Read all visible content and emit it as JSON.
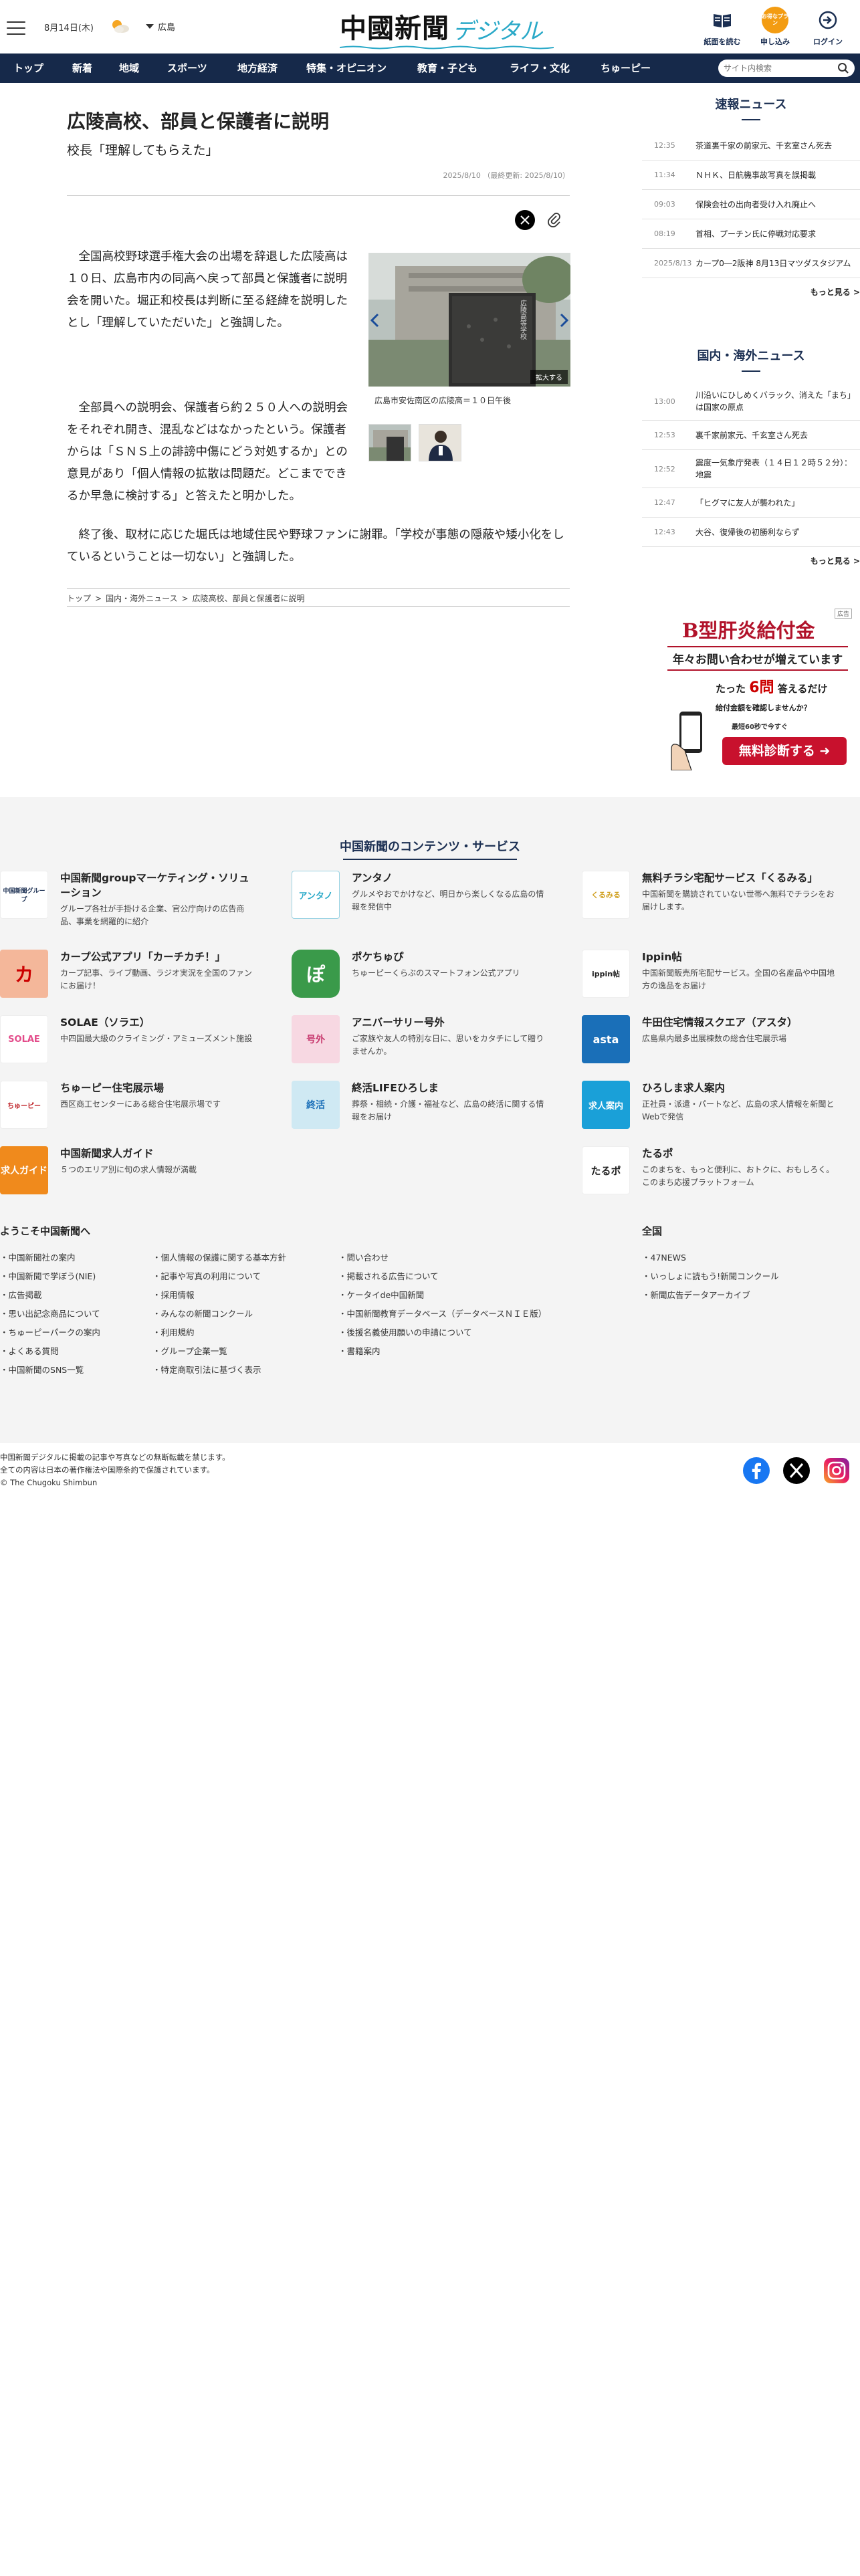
{
  "header": {
    "date": "8月14日(木)",
    "prefecture": "広島",
    "logo_main": "中國新聞",
    "logo_sub": "デジタル",
    "buttons": {
      "paper": "紙面を読む",
      "apply": "申し込み",
      "apply_badge": "お得なプラン",
      "login": "ログイン"
    }
  },
  "nav": {
    "items": [
      "トップ",
      "新着",
      "地域",
      "スポーツ",
      "地方経済",
      "特集・オピニオン",
      "教育・子ども",
      "ライフ・文化",
      "ちゅーピー"
    ],
    "search_placeholder": "サイト内検索"
  },
  "article": {
    "title": "広陵高校、部員と保護者に説明",
    "subtitle": "校長「理解してもらえた」",
    "date": "2025/8/10 （最終更新: 2025/8/10）",
    "paragraphs": [
      "全国高校野球選手権大会の出場を辞退した広陵高は１０日、広島市内の同高へ戻って部員と保護者に説明会を開いた。堀正和校長は判断に至る経緯を説明したとし「理解していただいた」と強調した。",
      "全部員への説明会、保護者ら約２５０人への説明会をそれぞれ開き、混乱などはなかったという。保護者からは「ＳＮＳ上の誹謗中傷にどう対処するか」との意見があり「個人情報の拡散は問題だ。どこまでできるか早急に検討する」と答えたと明かした。",
      "終了後、取材に応じた堀氏は地域住民や野球ファンに謝罪。「学校が事態の隠蔽や矮小化をしているということは一切ない」と強調した。"
    ],
    "photo_sign": "広陵高等学校",
    "enlarge": "拡大する",
    "caption": "広島市安佐南区の広陵高＝１０日午後",
    "breadcrumb": [
      "トップ",
      "国内・海外ニュース",
      "広陵高校、部員と保護者に説明"
    ]
  },
  "sidebar": {
    "breaking": {
      "title": "速報ニュース",
      "items": [
        {
          "time": "12:35",
          "text": "茶道裏千家の前家元、千玄室さん死去"
        },
        {
          "time": "11:34",
          "text": "ＮＨＫ、日航機事故写真を誤掲載"
        },
        {
          "time": "09:03",
          "text": "保険会社の出向者受け入れ廃止へ"
        },
        {
          "time": "08:19",
          "text": "首相、プーチン氏に停戦対応要求"
        },
        {
          "time": "2025/8/13",
          "text": "カープ0―2阪神 8月13日マツダスタジアム"
        }
      ],
      "more": "もっと見る"
    },
    "domestic": {
      "title": "国内・海外ニュース",
      "items": [
        {
          "time": "13:00",
          "text": "川沿いにひしめくバラック、消えた「まち」は国家の原点"
        },
        {
          "time": "12:53",
          "text": "裏千家前家元、千玄室さん死去"
        },
        {
          "time": "12:52",
          "text": "震度一気象庁発表（１４日１２時５２分）：地震"
        },
        {
          "time": "12:47",
          "text": "「ヒグマに友人が襲われた」"
        },
        {
          "time": "12:43",
          "text": "大谷、復帰後の初勝利ならず"
        }
      ],
      "more": "もっと見る"
    }
  },
  "ad": {
    "label": "広告",
    "headline": "B型肝炎給付金",
    "sub": "年々お問い合わせが増えています",
    "line1_pre": "たった",
    "line1_num": "6問",
    "line1_post": "答えるだけ",
    "line2": "給付金額を確認しませんか？",
    "line3": "最短60秒で今すぐ",
    "cta": "無料診断する"
  },
  "services": {
    "title": "中国新聞のコンテンツ・サービス",
    "items": [
      {
        "name": "中国新聞groupマーケティング・ソリューション",
        "desc": "グループ各社が手掛ける企業、官公庁向けの広告商品、事業を網羅的に紹介",
        "logo": "中国新聞グループ"
      },
      {
        "name": "アンタノ",
        "desc": "グルメやおでかけなど、明日から楽しくなる広島の情報を発信中",
        "logo": "アンタノ"
      },
      {
        "name": "無料チラシ宅配サービス「くるみる」",
        "desc": "中国新聞を購読されていない世帯へ無料でチラシをお届けします。",
        "logo": "くるみる"
      },
      {
        "name": "カープ公式アプリ「カーチカチ！」",
        "desc": "カープ記事、ライブ動画、ラジオ実況を全国のファンにお届け！",
        "logo": "カ"
      },
      {
        "name": "ポケちゅぴ",
        "desc": "ちゅーピーくらぶのスマートフォン公式アプリ",
        "logo": "ぽ"
      },
      {
        "name": "Ippin帖",
        "desc": "中国新聞販売所宅配サービス。全国の名産品や中国地方の逸品をお届け",
        "logo": "ippin帖"
      },
      {
        "name": "SOLAE（ソラエ）",
        "desc": "中四国最大級のクライミング・アミューズメント施設",
        "logo": "SOLAE"
      },
      {
        "name": "アニバーサリー号外",
        "desc": "ご家族や友人の特別な日に、思いをカタチにして贈りませんか。",
        "logo": "号外"
      },
      {
        "name": "牛田住宅情報スクエア（アスタ）",
        "desc": "広島県内最多出展棟数の総合住宅展示場",
        "logo": "asta"
      },
      {
        "name": "ちゅーピー住宅展示場",
        "desc": "西区商工センターにある総合住宅展示場です",
        "logo": "ちゅーピー"
      },
      {
        "name": "終活LIFEひろしま",
        "desc": "葬祭・相続・介護・福祉など、広島の終活に関する情報をお届け",
        "logo": "終活"
      },
      {
        "name": "ひろしま求人案内",
        "desc": "正社員・派遣・パートなど、広島の求人情報を新聞とWebで発信",
        "logo": "求人案内"
      },
      {
        "name": "中国新聞求人ガイド",
        "desc": "５つのエリア別に旬の求人情報が満載",
        "logo": "求人ガイド"
      },
      {
        "name": "たるポ",
        "desc": "このまちを、もっと便利に、おトクに、おもしろく。このまち応援プラットフォーム",
        "logo": "たるポ"
      }
    ]
  },
  "footer": {
    "welcome": "ようこそ中国新聞へ",
    "col1": [
      "中国新聞社の案内",
      "中国新聞で学ぼう(NIE)",
      "広告掲載",
      "思い出記念商品について",
      "ちゅーピーパークの案内",
      "よくある質問",
      "中国新聞のSNS一覧"
    ],
    "col2": [
      "個人情報の保護に関する基本方針",
      "記事や写真の利用について",
      "採用情報",
      "みんなの新聞コンクール",
      "利用規約",
      "グループ企業一覧",
      "特定商取引法に基づく表示"
    ],
    "col3": [
      "問い合わせ",
      "掲載される広告について",
      "ケータイde中国新聞",
      "中国新聞教育データベース（データベースＮＩＥ版）",
      "後援名義使用願いの申請について",
      "書籍案内"
    ],
    "national": "全国",
    "col4": [
      "47NEWS",
      "いっしょに読もう!新聞コンクール",
      "新聞広告データアーカイブ"
    ],
    "copyright": [
      "中国新聞デジタルに掲載の記事や写真などの無断転載を禁じます。",
      "全ての内容は日本の著作権法や国際条約で保護されています。",
      "© The Chugoku Shimbun"
    ]
  },
  "colors": {
    "navy": "#16294a",
    "accent": "#2aa9c8",
    "ad_red": "#c8112d"
  }
}
